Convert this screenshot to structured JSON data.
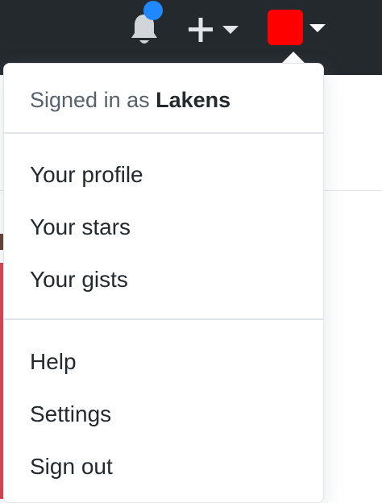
{
  "header": {
    "icons": {
      "bell": "bell-icon",
      "plus": "plus-icon",
      "caret": "caret-down-icon"
    },
    "colors": {
      "background": "#24292e",
      "notification_dot": "#2188ff",
      "avatar": "#ff0000"
    }
  },
  "dropdown": {
    "signed_in_prefix": "Signed in as",
    "username": "Lakens",
    "group1": [
      {
        "label": "Your profile"
      },
      {
        "label": "Your stars"
      },
      {
        "label": "Your gists"
      }
    ],
    "group2": [
      {
        "label": "Help"
      },
      {
        "label": "Settings"
      },
      {
        "label": "Sign out"
      }
    ]
  }
}
